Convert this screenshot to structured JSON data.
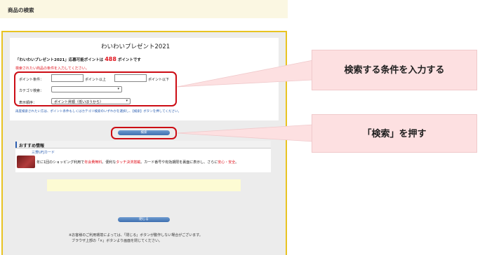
{
  "header": {
    "title": "商品の検索"
  },
  "present": {
    "title": "わいわいプレゼント2021",
    "points_prefix": "「わいわいプレゼント2021」応募可能ポイントは",
    "points_value": "488",
    "points_suffix": "ポイントです",
    "hint": "検索されたい商品の条件を入力してください。"
  },
  "conditions": {
    "point_label": "ポイント条件：",
    "point_min_suffix": "ポイント以上",
    "point_max_suffix": "ポイント以下",
    "category_label": "カテゴリ検索：",
    "category_value": "",
    "order_label": "表示順序：",
    "order_value": "ポイント昇順（低いほうから）"
  },
  "note": "再度検索されたい方は、ポイント条件もしくはカテゴリ検索のいずれかを選択し、【検索】ボタンを押してください。",
  "buttons": {
    "search": "検索",
    "close": "閉じる"
  },
  "recommend": {
    "header": "おすすめ情報",
    "card_title": "三菱UFJカード",
    "desc_1": "年に1回のショッピング利用で",
    "desc_2": "年会費無料",
    "desc_3": "。便利な",
    "desc_4": "タッチ決済搭載",
    "desc_5": "。カード番号や有効期限を裏面に表示し、さらに",
    "desc_6": "安心・安全",
    "desc_7": "。"
  },
  "footer": {
    "line1": "※お客様のご利用環境によっては、「閉じる」ボタンが動作しない場合がございます。",
    "line2": "ブラウザ上部の「×」ボタンより画面を閉じてください。"
  },
  "callouts": {
    "conditions": "検索する条件を入力する",
    "press": "「検索」を押す"
  },
  "colors": {
    "accent_red": "#cc0c14",
    "frame_yellow": "#e8c321",
    "callout_bg": "#fde0e1",
    "button_blue": "#3d6fb0"
  }
}
